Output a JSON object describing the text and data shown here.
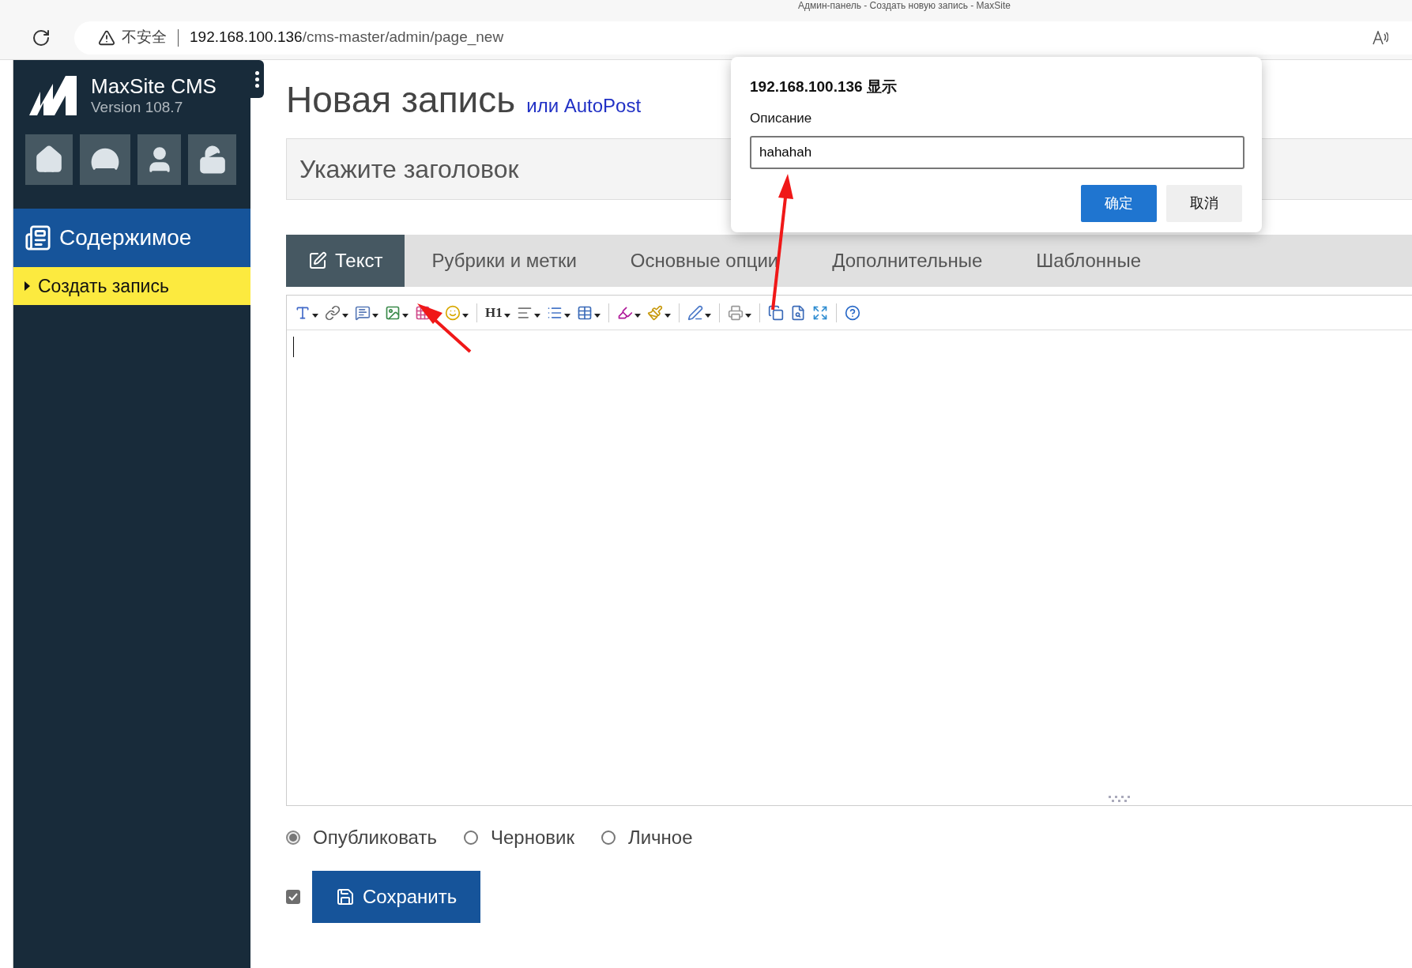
{
  "browser": {
    "tab_title": "Админ-панель - Создать новую запись - MaxSite",
    "security_label": "不安全",
    "url_host": "192.168.100.136",
    "url_path": "/cms-master/admin/page_new"
  },
  "sidebar": {
    "brand": "MaxSite CMS",
    "version": "Version 108.7",
    "section": "Содержимое",
    "items": [
      {
        "label": "Создать запись",
        "selected": true
      }
    ]
  },
  "page": {
    "heading": "Новая запись",
    "heading_link": "или AutoPost",
    "title_placeholder": "Укажите заголовок"
  },
  "tabs": [
    {
      "label": "Текст",
      "selected": true
    },
    {
      "label": "Рубрики и метки",
      "selected": false
    },
    {
      "label": "Основные опции",
      "selected": false
    },
    {
      "label": "Дополнительные",
      "selected": false
    },
    {
      "label": "Шаблонные",
      "selected": false
    }
  ],
  "toolbar": {
    "heading_label": "H1"
  },
  "status_options": [
    {
      "label": "Опубликовать",
      "selected": true
    },
    {
      "label": "Черновик",
      "selected": false
    },
    {
      "label": "Личное",
      "selected": false
    }
  ],
  "save_checkbox": {
    "checked": true
  },
  "save_button": "Сохранить",
  "dialog": {
    "title": "192.168.100.136 显示",
    "label": "Описание",
    "value": "hahahah",
    "ok": "确定",
    "cancel": "取消"
  }
}
